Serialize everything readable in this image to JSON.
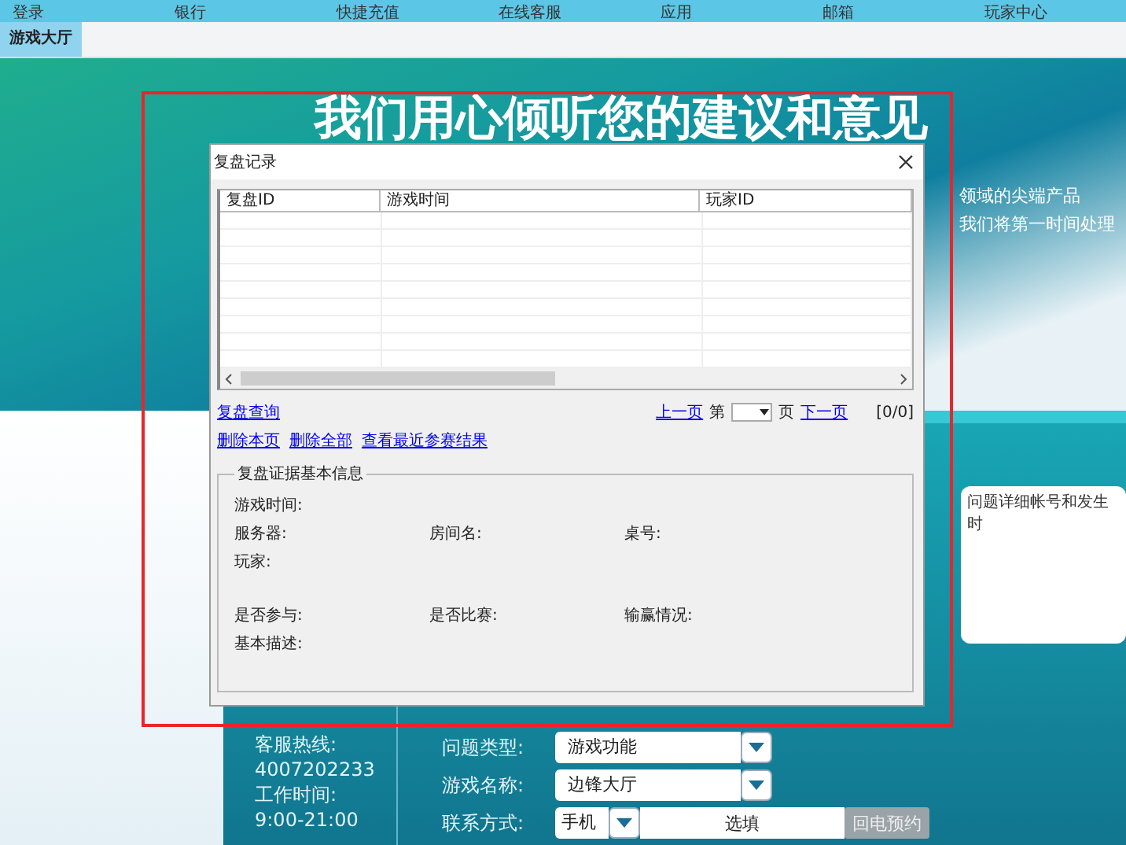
{
  "top_menu": [
    "登录",
    "银行",
    "快捷充值",
    "在线客服",
    "应用",
    "邮箱",
    "玩家中心"
  ],
  "tabs": [
    {
      "label": "游戏大厅",
      "selected": true
    }
  ],
  "banner": {
    "title": "我们用心倾听您的建议和意见",
    "lines": [
      "领域的尖端产品",
      "我们将第一时间处理"
    ]
  },
  "feedback_panel": {
    "hotline_label": "客服热线:",
    "hotline": "4007202233",
    "hours_label": "工作时间:",
    "hours": "9:00-21:00",
    "fields": [
      {
        "label": "问题类型:",
        "value": "游戏功能",
        "kind": "dropdown"
      },
      {
        "label": "游戏名称:",
        "value": "边锋大厅",
        "kind": "dropdown"
      },
      {
        "label": "联系方式:",
        "value": "手机",
        "placeholder": "选填",
        "button": "回电预约",
        "kind": "contact"
      }
    ],
    "description_hint": "问题详细帐号和发生时"
  },
  "dialog": {
    "title": "复盘记录",
    "columns": [
      "复盘ID",
      "游戏时间",
      "玩家ID"
    ],
    "query_link": "复盘查询",
    "prev": "上一页",
    "page_prefix": "第",
    "page_suffix": "页",
    "next": "下一页",
    "count": "[0/0]",
    "actions": [
      "删除本页",
      "删除全部",
      "查看最近参赛结果"
    ],
    "group_title": "复盘证据基本信息",
    "info_rows": [
      [
        "游戏时间:"
      ],
      [
        "服务器:",
        "房间名:",
        "桌号:"
      ],
      [
        "玩家:"
      ],
      [
        "是否参与:",
        "是否比赛:",
        "输赢情况:"
      ],
      [
        "基本描述:"
      ]
    ]
  },
  "highlight_frame": {
    "color": "#e8262a"
  }
}
